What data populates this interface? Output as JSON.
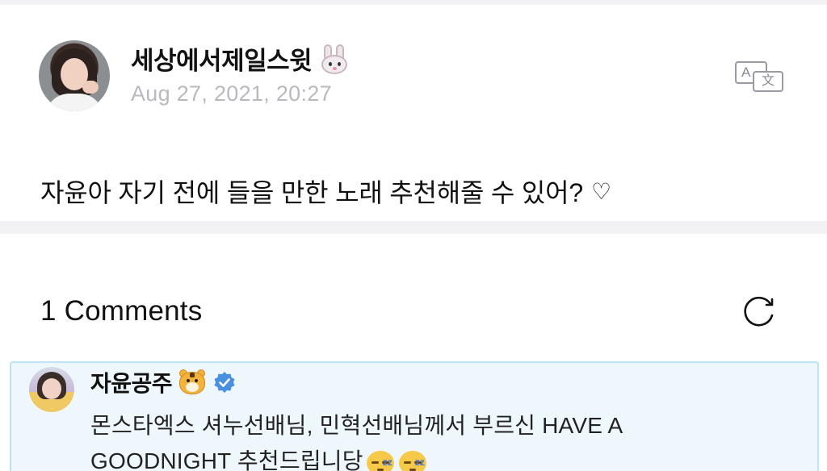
{
  "post": {
    "author_name": "세상에서제일스윗",
    "author_emoji": "rabbit-face-emoji",
    "timestamp": "Aug 27, 2021, 20:27",
    "translate_icon": "translate-icon",
    "body_text": "자윤아 자기 전에 들을 만한 노래 추천해줄 수 있어?",
    "body_heart": "♡"
  },
  "comments": {
    "count_label": "1 Comments",
    "refresh_icon": "refresh-icon",
    "items": [
      {
        "author_name": "자윤공주",
        "author_emoji": "tiger-face-emoji",
        "verified_icon": "verified-badge-icon",
        "verified_color": "#4a90e2",
        "text_line1": "몬스타엑스 셔누선배님, 민혁선배님께서 부르신 HAVE A",
        "text_line2": "GOODNIGHT 추천드립니당",
        "trailing_emojis": [
          "sleeping-face-emoji",
          "sleeping-face-emoji"
        ]
      }
    ]
  },
  "colors": {
    "timestamp": "#b9b9c0",
    "divider": "#f2f2f5",
    "comment_bg": "#eef7fc",
    "comment_border": "#bfe3f6"
  }
}
